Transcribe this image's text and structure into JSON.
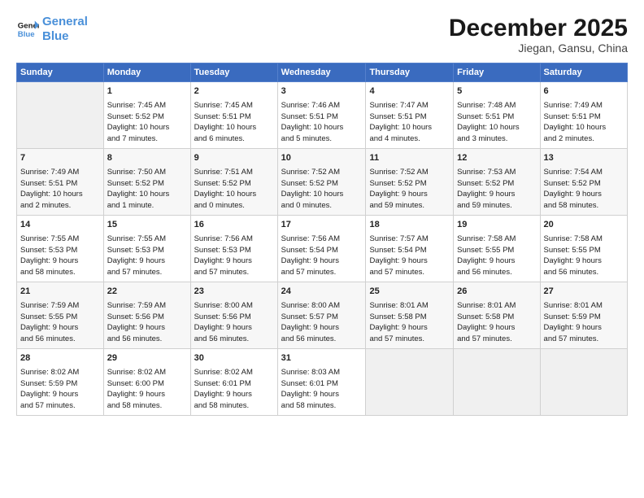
{
  "header": {
    "logo_line1": "General",
    "logo_line2": "Blue",
    "month": "December 2025",
    "location": "Jiegan, Gansu, China"
  },
  "weekdays": [
    "Sunday",
    "Monday",
    "Tuesday",
    "Wednesday",
    "Thursday",
    "Friday",
    "Saturday"
  ],
  "rows": [
    [
      {
        "day": "",
        "info": ""
      },
      {
        "day": "1",
        "info": "Sunrise: 7:45 AM\nSunset: 5:52 PM\nDaylight: 10 hours\nand 7 minutes."
      },
      {
        "day": "2",
        "info": "Sunrise: 7:45 AM\nSunset: 5:51 PM\nDaylight: 10 hours\nand 6 minutes."
      },
      {
        "day": "3",
        "info": "Sunrise: 7:46 AM\nSunset: 5:51 PM\nDaylight: 10 hours\nand 5 minutes."
      },
      {
        "day": "4",
        "info": "Sunrise: 7:47 AM\nSunset: 5:51 PM\nDaylight: 10 hours\nand 4 minutes."
      },
      {
        "day": "5",
        "info": "Sunrise: 7:48 AM\nSunset: 5:51 PM\nDaylight: 10 hours\nand 3 minutes."
      },
      {
        "day": "6",
        "info": "Sunrise: 7:49 AM\nSunset: 5:51 PM\nDaylight: 10 hours\nand 2 minutes."
      }
    ],
    [
      {
        "day": "7",
        "info": "Sunrise: 7:49 AM\nSunset: 5:51 PM\nDaylight: 10 hours\nand 2 minutes."
      },
      {
        "day": "8",
        "info": "Sunrise: 7:50 AM\nSunset: 5:52 PM\nDaylight: 10 hours\nand 1 minute."
      },
      {
        "day": "9",
        "info": "Sunrise: 7:51 AM\nSunset: 5:52 PM\nDaylight: 10 hours\nand 0 minutes."
      },
      {
        "day": "10",
        "info": "Sunrise: 7:52 AM\nSunset: 5:52 PM\nDaylight: 10 hours\nand 0 minutes."
      },
      {
        "day": "11",
        "info": "Sunrise: 7:52 AM\nSunset: 5:52 PM\nDaylight: 9 hours\nand 59 minutes."
      },
      {
        "day": "12",
        "info": "Sunrise: 7:53 AM\nSunset: 5:52 PM\nDaylight: 9 hours\nand 59 minutes."
      },
      {
        "day": "13",
        "info": "Sunrise: 7:54 AM\nSunset: 5:52 PM\nDaylight: 9 hours\nand 58 minutes."
      }
    ],
    [
      {
        "day": "14",
        "info": "Sunrise: 7:55 AM\nSunset: 5:53 PM\nDaylight: 9 hours\nand 58 minutes."
      },
      {
        "day": "15",
        "info": "Sunrise: 7:55 AM\nSunset: 5:53 PM\nDaylight: 9 hours\nand 57 minutes."
      },
      {
        "day": "16",
        "info": "Sunrise: 7:56 AM\nSunset: 5:53 PM\nDaylight: 9 hours\nand 57 minutes."
      },
      {
        "day": "17",
        "info": "Sunrise: 7:56 AM\nSunset: 5:54 PM\nDaylight: 9 hours\nand 57 minutes."
      },
      {
        "day": "18",
        "info": "Sunrise: 7:57 AM\nSunset: 5:54 PM\nDaylight: 9 hours\nand 57 minutes."
      },
      {
        "day": "19",
        "info": "Sunrise: 7:58 AM\nSunset: 5:55 PM\nDaylight: 9 hours\nand 56 minutes."
      },
      {
        "day": "20",
        "info": "Sunrise: 7:58 AM\nSunset: 5:55 PM\nDaylight: 9 hours\nand 56 minutes."
      }
    ],
    [
      {
        "day": "21",
        "info": "Sunrise: 7:59 AM\nSunset: 5:55 PM\nDaylight: 9 hours\nand 56 minutes."
      },
      {
        "day": "22",
        "info": "Sunrise: 7:59 AM\nSunset: 5:56 PM\nDaylight: 9 hours\nand 56 minutes."
      },
      {
        "day": "23",
        "info": "Sunrise: 8:00 AM\nSunset: 5:56 PM\nDaylight: 9 hours\nand 56 minutes."
      },
      {
        "day": "24",
        "info": "Sunrise: 8:00 AM\nSunset: 5:57 PM\nDaylight: 9 hours\nand 56 minutes."
      },
      {
        "day": "25",
        "info": "Sunrise: 8:01 AM\nSunset: 5:58 PM\nDaylight: 9 hours\nand 57 minutes."
      },
      {
        "day": "26",
        "info": "Sunrise: 8:01 AM\nSunset: 5:58 PM\nDaylight: 9 hours\nand 57 minutes."
      },
      {
        "day": "27",
        "info": "Sunrise: 8:01 AM\nSunset: 5:59 PM\nDaylight: 9 hours\nand 57 minutes."
      }
    ],
    [
      {
        "day": "28",
        "info": "Sunrise: 8:02 AM\nSunset: 5:59 PM\nDaylight: 9 hours\nand 57 minutes."
      },
      {
        "day": "29",
        "info": "Sunrise: 8:02 AM\nSunset: 6:00 PM\nDaylight: 9 hours\nand 58 minutes."
      },
      {
        "day": "30",
        "info": "Sunrise: 8:02 AM\nSunset: 6:01 PM\nDaylight: 9 hours\nand 58 minutes."
      },
      {
        "day": "31",
        "info": "Sunrise: 8:03 AM\nSunset: 6:01 PM\nDaylight: 9 hours\nand 58 minutes."
      },
      {
        "day": "",
        "info": ""
      },
      {
        "day": "",
        "info": ""
      },
      {
        "day": "",
        "info": ""
      }
    ]
  ]
}
